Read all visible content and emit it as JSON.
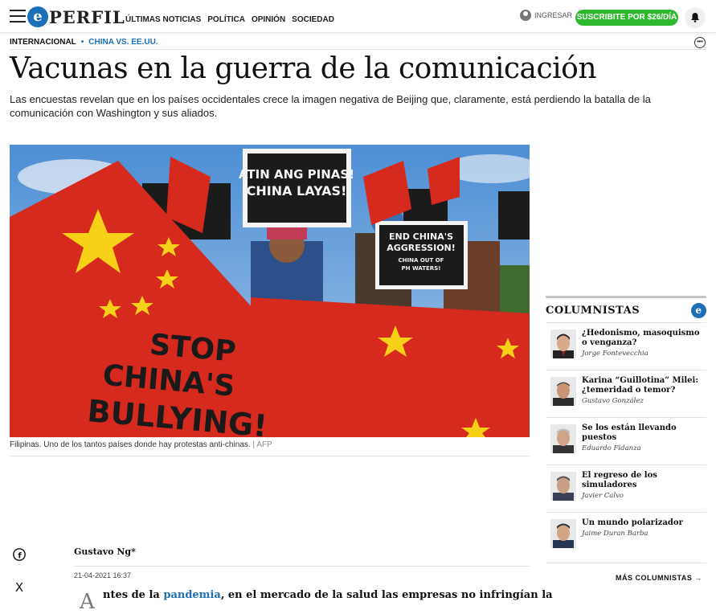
{
  "header": {
    "logo_letter": "e",
    "logo_text": "PERFIL",
    "nav": [
      "ÚLTIMAS NOTICIAS",
      "POLÍTICA",
      "OPINIÓN",
      "SOCIEDAD"
    ],
    "login_label": "INGRESAR",
    "subscribe_label": "SUSCRIBITE POR $26/DÍA"
  },
  "section": {
    "main": "INTERNACIONAL",
    "separator": "•",
    "sub": "CHINA VS. EE.UU."
  },
  "article": {
    "headline": "Vacunas en la guerra de la comunicación",
    "lede": "Las encuestas revelan que en los países occidentales crece la imagen negativa de Beijing que, claramente, está perdiendo la batalla de la comunicación con Washington y sus aliados.",
    "photo": {
      "caption": "Filipinas. Uno de los tantos países donde hay protestas anti-chinas.",
      "credit": "| AFP",
      "sign_1": [
        "ATIN ANG PINAS!",
        "CHINA LAYAS!"
      ],
      "sign_2": [
        "END CHINA'S",
        "AGGRESSION!",
        "CHINA OUT OF",
        "PH WATERS!"
      ],
      "flag_text": [
        "STOP",
        "CHINA'S",
        "BULLYING!"
      ]
    },
    "author": "Gustavo Ng*",
    "date": "21-04-2021 16:37",
    "dropcap": "A",
    "body_before": "ntes de la ",
    "body_link": "pandemia",
    "body_after": ", en el mercado de la salud las empresas no infringían la"
  },
  "share": {
    "facebook": "f",
    "x": "X"
  },
  "columnists": {
    "title": "COLUMNISTAS",
    "logo": "e",
    "items": [
      {
        "headline": "¿Hedonismo, masoquismo o venganza?",
        "author": "Jorge Fontevecchia"
      },
      {
        "headline": "Karina “Guillotina” Milei: ¿temeridad o temor?",
        "author": "Gustavo González"
      },
      {
        "headline": "Se los están llevando puestos",
        "author": "Eduardo Fidanza"
      },
      {
        "headline": "El regreso de los simuladores",
        "author": "Javier Calvo"
      },
      {
        "headline": "Un mundo polarizador",
        "author": "Jaime Duran Barba"
      }
    ],
    "more_label": "MÁS COLUMNISTAS →"
  },
  "colors": {
    "brand": "#1d6fb8",
    "subscribe": "#2db82d",
    "flag_red": "#d62a1e",
    "flag_star": "#f7d117"
  }
}
